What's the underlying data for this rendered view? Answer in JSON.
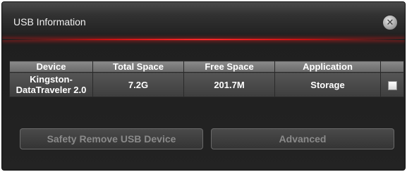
{
  "window": {
    "title": "USB Information",
    "close_icon": "close-icon"
  },
  "table": {
    "columns": [
      "Device",
      "Total Space",
      "Free Space",
      "Application",
      ""
    ],
    "rows": [
      {
        "device": "Kingston-\nDataTraveler 2.0",
        "total_space": "7.2G",
        "free_space": "201.7M",
        "application": "Storage",
        "selected": false
      }
    ]
  },
  "buttons": {
    "safety_remove": "Safety Remove USB Device",
    "advanced": "Advanced"
  },
  "colors": {
    "accent_line": "#ff2a2a",
    "background": "#232323"
  }
}
